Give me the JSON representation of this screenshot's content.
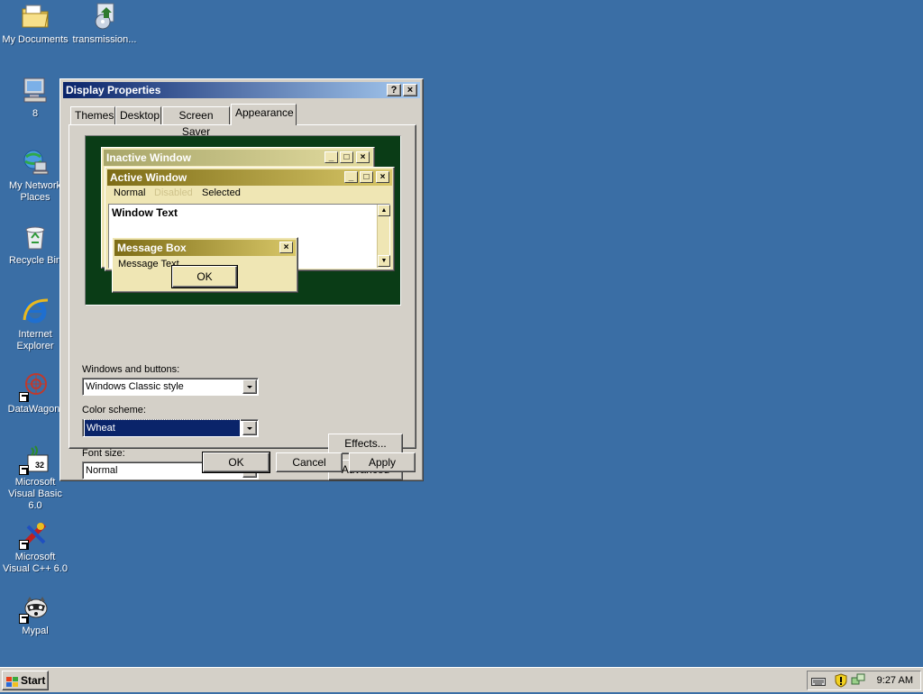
{
  "desktop": {
    "icons": [
      {
        "label": "My Documents",
        "icon": "folder-documents-icon"
      },
      {
        "label": "transmission...",
        "icon": "installer-icon"
      },
      {
        "label": "8",
        "icon": "computer-icon"
      },
      {
        "label": "My Network Places",
        "icon": "network-places-icon"
      },
      {
        "label": "Recycle Bin",
        "icon": "recycle-bin-icon"
      },
      {
        "label": "Internet Explorer",
        "icon": "internet-explorer-icon"
      },
      {
        "label": "DataWagon.",
        "icon": "datawagon-icon"
      },
      {
        "label": "Microsoft Visual Basic 6.0",
        "icon": "visual-basic-icon"
      },
      {
        "label": "Microsoft Visual C++ 6.0",
        "icon": "visual-cpp-icon"
      },
      {
        "label": "Mypal",
        "icon": "mypal-raccoon-icon"
      }
    ]
  },
  "dialog": {
    "title": "Display Properties",
    "help_button": "?",
    "close_button": "×",
    "tabs": [
      {
        "label": "Themes",
        "active": false
      },
      {
        "label": "Desktop",
        "active": false
      },
      {
        "label": "Screen Saver",
        "active": false
      },
      {
        "label": "Appearance",
        "active": true
      }
    ],
    "preview": {
      "inactive_title": "Inactive Window",
      "active_title": "Active Window",
      "menu_normal": "Normal",
      "menu_disabled": "Disabled",
      "menu_selected": "Selected",
      "window_text": "Window Text",
      "message_box_title": "Message Box",
      "message_text": "Message Text",
      "ok": "OK"
    },
    "windows_buttons": {
      "label": "Windows and buttons:",
      "value": "Windows Classic style"
    },
    "color_scheme": {
      "label": "Color scheme:",
      "value": "Wheat"
    },
    "font_size": {
      "label": "Font size:",
      "value": "Normal"
    },
    "effects_button": "Effects...",
    "advanced_button": "Advanced",
    "ok_button": "OK",
    "cancel_button": "Cancel",
    "apply_button": "Apply"
  },
  "taskbar": {
    "start_label": "Start",
    "clock": "9:27 AM"
  },
  "colors": {
    "desktop": "#3a6ea5",
    "title_active": "#0a246a",
    "preview_bg": "#0a3c16",
    "wheat_active": "#7d6c16",
    "wheat_face": "#efe6b4"
  }
}
